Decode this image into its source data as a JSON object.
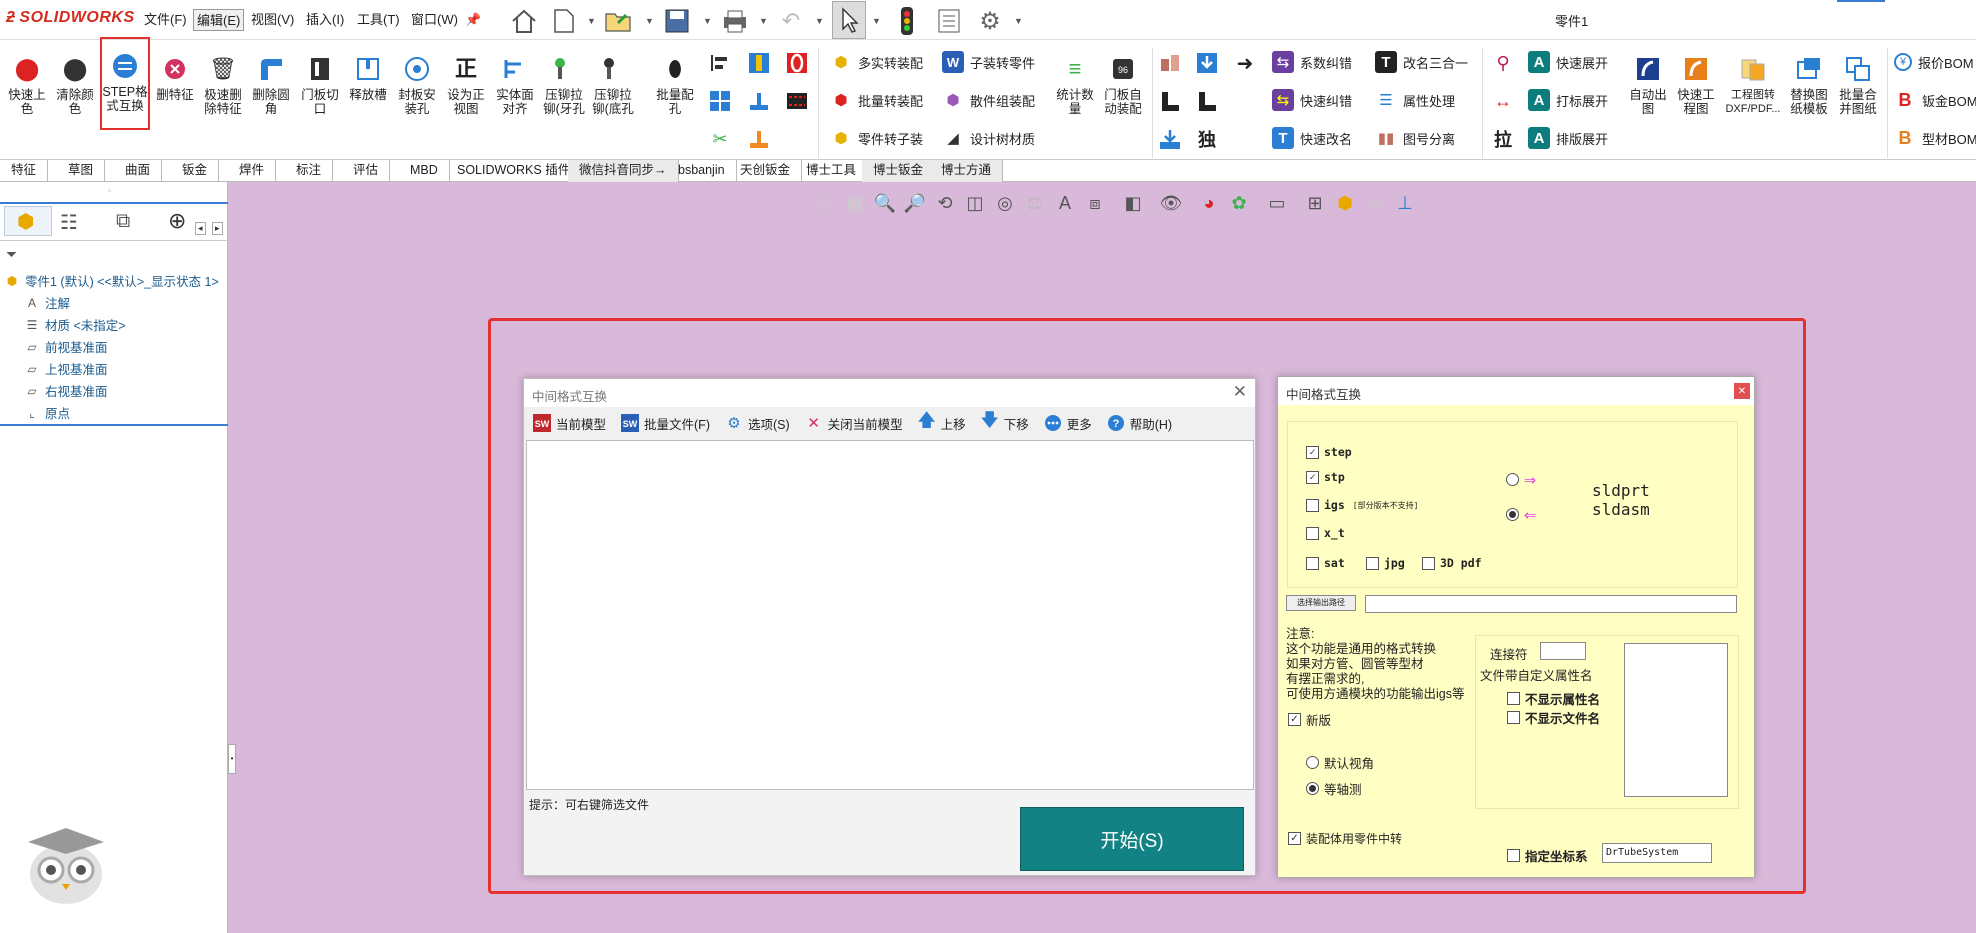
{
  "menubar": {
    "logo": "SOLIDWORKS",
    "items": [
      "文件(F)",
      "编辑(E)",
      "视图(V)",
      "插入(I)",
      "工具(T)",
      "窗口(W)"
    ],
    "doc_title": "零件1"
  },
  "ribbon": {
    "big_buttons": [
      {
        "label": "快速上色",
        "icon": "paint-drops-icon"
      },
      {
        "label": "清除颜色",
        "icon": "paint-clear-icon"
      },
      {
        "label": "STEP格式互换",
        "icon": "step-convert-icon"
      },
      {
        "label": "删特征",
        "icon": "delete-feature-icon"
      },
      {
        "label": "极速删除特征",
        "icon": "trash-icon"
      },
      {
        "label": "删除圆角",
        "icon": "remove-fillet-icon"
      },
      {
        "label": "门板切口",
        "icon": "door-cut-icon"
      },
      {
        "label": "释放槽",
        "icon": "relief-slot-icon"
      },
      {
        "label": "封板安装孔",
        "icon": "mount-hole-icon"
      },
      {
        "label": "设为正视图",
        "icon": "front-view-icon"
      },
      {
        "label": "实体面对齐",
        "icon": "align-face-icon"
      },
      {
        "label": "压铆拉铆(牙孔",
        "icon": "rivet-thread-icon"
      },
      {
        "label": "压铆拉铆(底孔",
        "icon": "rivet-hole-icon"
      },
      {
        "label": "批量配孔",
        "icon": "batch-hole-icon"
      }
    ],
    "col1": [
      {
        "label": "多实转装配",
        "icon": "multibody-icon"
      },
      {
        "label": "批量转装配",
        "icon": "batch-assembly-icon"
      },
      {
        "label": "零件转子装",
        "icon": "part-subassembly-icon"
      }
    ],
    "col2": [
      {
        "label": "子装转零件",
        "icon": "subassembly-part-icon"
      },
      {
        "label": "散件组装配",
        "icon": "loose-parts-icon"
      },
      {
        "label": "设计树材质",
        "icon": "tree-material-icon"
      }
    ],
    "big2": [
      {
        "label": "统计数量",
        "icon": "count-icon"
      },
      {
        "label": "门板自动装配",
        "icon": "door-auto-icon"
      }
    ],
    "col3": [
      {
        "label": "系数纠错",
        "icon": "coefficient-icon"
      },
      {
        "label": "快速纠错",
        "icon": "quick-fix-icon"
      },
      {
        "label": "快速改名",
        "icon": "rename-icon"
      }
    ],
    "col4": [
      {
        "label": "改名三合一",
        "icon": "rename-three-icon"
      },
      {
        "label": "属性处理",
        "icon": "property-icon"
      },
      {
        "label": "图号分离",
        "icon": "drawing-number-icon"
      }
    ],
    "col5": [
      {
        "label": "快速展开",
        "icon": "quick-unfold-icon"
      },
      {
        "label": "打标展开",
        "icon": "mark-unfold-icon"
      },
      {
        "label": "排版展开",
        "icon": "layout-unfold-icon"
      }
    ],
    "big3": [
      {
        "label": "自动出图",
        "icon": "auto-drawing-icon"
      },
      {
        "label": "快速工程图",
        "icon": "quick-drawing-icon"
      },
      {
        "label": "工程图转DXF/PDF...",
        "icon": "dxf-pdf-icon"
      },
      {
        "label": "替换图纸模板",
        "icon": "template-icon"
      },
      {
        "label": "批量合并图纸",
        "icon": "merge-icon"
      }
    ],
    "col6": [
      {
        "label": "报价BOM",
        "icon": "quote-bom-icon"
      },
      {
        "label": "钣金BOM",
        "icon": "sheet-bom-icon"
      },
      {
        "label": "型材BOM",
        "icon": "profile-bom-icon"
      }
    ],
    "misc_glyph": "独",
    "misc_glyph2": "拉"
  },
  "tabs": [
    "特征",
    "草图",
    "曲面",
    "钣金",
    "焊件",
    "标注",
    "评估",
    "MBD",
    "SOLIDWORKS 插件",
    "微信抖音同步→",
    "bsbanjin",
    "天创钣金",
    "博士工具",
    "博士钣金",
    "博士方通"
  ],
  "tree": {
    "root": "零件1 (默认) <<默认>_显示状态 1>",
    "items": [
      "注解",
      "材质 <未指定>",
      "前视基准面",
      "上视基准面",
      "右视基准面",
      "原点"
    ]
  },
  "dialog1": {
    "title": "中间格式互换",
    "toolbar": [
      {
        "label": "当前模型",
        "icon": "sw-model-icon"
      },
      {
        "label": "批量文件(F)",
        "icon": "sw-batch-icon"
      },
      {
        "label": "选项(S)",
        "icon": "gear-icon"
      },
      {
        "label": "关闭当前模型",
        "icon": "close-icon"
      },
      {
        "label": "上移",
        "icon": "arrow-up-icon"
      },
      {
        "label": "下移",
        "icon": "arrow-down-icon"
      },
      {
        "label": "更多",
        "icon": "more-icon"
      },
      {
        "label": "帮助(H)",
        "icon": "help-icon"
      }
    ],
    "hint": "提示：可右键筛选文件",
    "start": "开始(S)"
  },
  "dialog2": {
    "title": "中间格式互换",
    "formats": {
      "step": "step",
      "stp": "stp",
      "igs": "igs",
      "igs_note": "[部分版本不支持]",
      "xt": "x_t",
      "sat": "sat",
      "jpg": "jpg",
      "pdf3d": "3D pdf"
    },
    "targets": [
      "sldprt",
      "sldasm"
    ],
    "output_btn": "选择输出路径",
    "note": [
      "注意:",
      "这个功能是通用的格式转换",
      "如果对方管、圆管等型材",
      "有摆正需求的,",
      "可使用方通模块的功能输出igs等"
    ],
    "new_version": "新版",
    "views": [
      "默认视角",
      "等轴测"
    ],
    "connector_label": "连接符",
    "custom_prop": "文件带自定义属性名",
    "hide_prop": "不显示属性名",
    "hide_file": "不显示文件名",
    "assembly_note": "装配体用零件中转",
    "coord_label": "指定坐标系",
    "coord_value": "DrTubeSystem"
  }
}
